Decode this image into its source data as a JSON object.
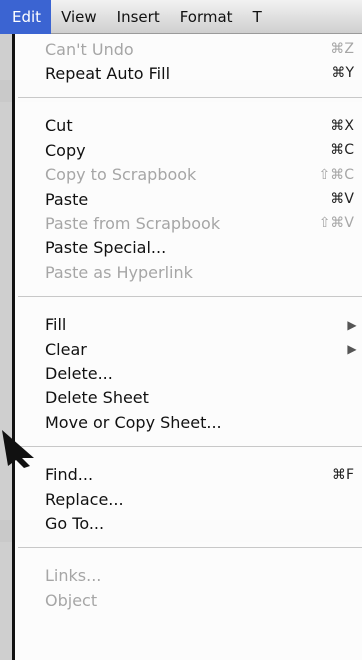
{
  "menubar": {
    "items": [
      "Edit",
      "View",
      "Insert",
      "Format",
      "T"
    ]
  },
  "menu": {
    "groups": [
      [
        {
          "label": "Can't Undo",
          "shortcut": "⌘Z",
          "enabled": false
        },
        {
          "label": "Repeat Auto Fill",
          "shortcut": "⌘Y",
          "enabled": true
        }
      ],
      [
        {
          "label": "Cut",
          "shortcut": "⌘X",
          "enabled": true
        },
        {
          "label": "Copy",
          "shortcut": "⌘C",
          "enabled": true
        },
        {
          "label": "Copy to Scrapbook",
          "shortcut": "⇧⌘C",
          "enabled": false
        },
        {
          "label": "Paste",
          "shortcut": "⌘V",
          "enabled": true
        },
        {
          "label": "Paste from Scrapbook",
          "shortcut": "⇧⌘V",
          "enabled": false
        },
        {
          "label": "Paste Special...",
          "shortcut": "",
          "enabled": true
        },
        {
          "label": "Paste as Hyperlink",
          "shortcut": "",
          "enabled": false
        }
      ],
      [
        {
          "label": "Fill",
          "shortcut": "",
          "enabled": true,
          "submenu": true
        },
        {
          "label": "Clear",
          "shortcut": "",
          "enabled": true,
          "submenu": true
        },
        {
          "label": "Delete...",
          "shortcut": "",
          "enabled": true
        },
        {
          "label": "Delete Sheet",
          "shortcut": "",
          "enabled": true
        },
        {
          "label": "Move or Copy Sheet...",
          "shortcut": "",
          "enabled": true
        }
      ],
      [
        {
          "label": "Find...",
          "shortcut": "⌘F",
          "enabled": true
        },
        {
          "label": "Replace...",
          "shortcut": "",
          "enabled": true
        },
        {
          "label": "Go To...",
          "shortcut": "",
          "enabled": true
        }
      ],
      [
        {
          "label": "Links...",
          "shortcut": "",
          "enabled": false
        },
        {
          "label": "Object",
          "shortcut": "",
          "enabled": false
        }
      ]
    ]
  },
  "colors": {
    "highlight": "#3b64d2",
    "disabled_text": "#a6a6a6"
  }
}
